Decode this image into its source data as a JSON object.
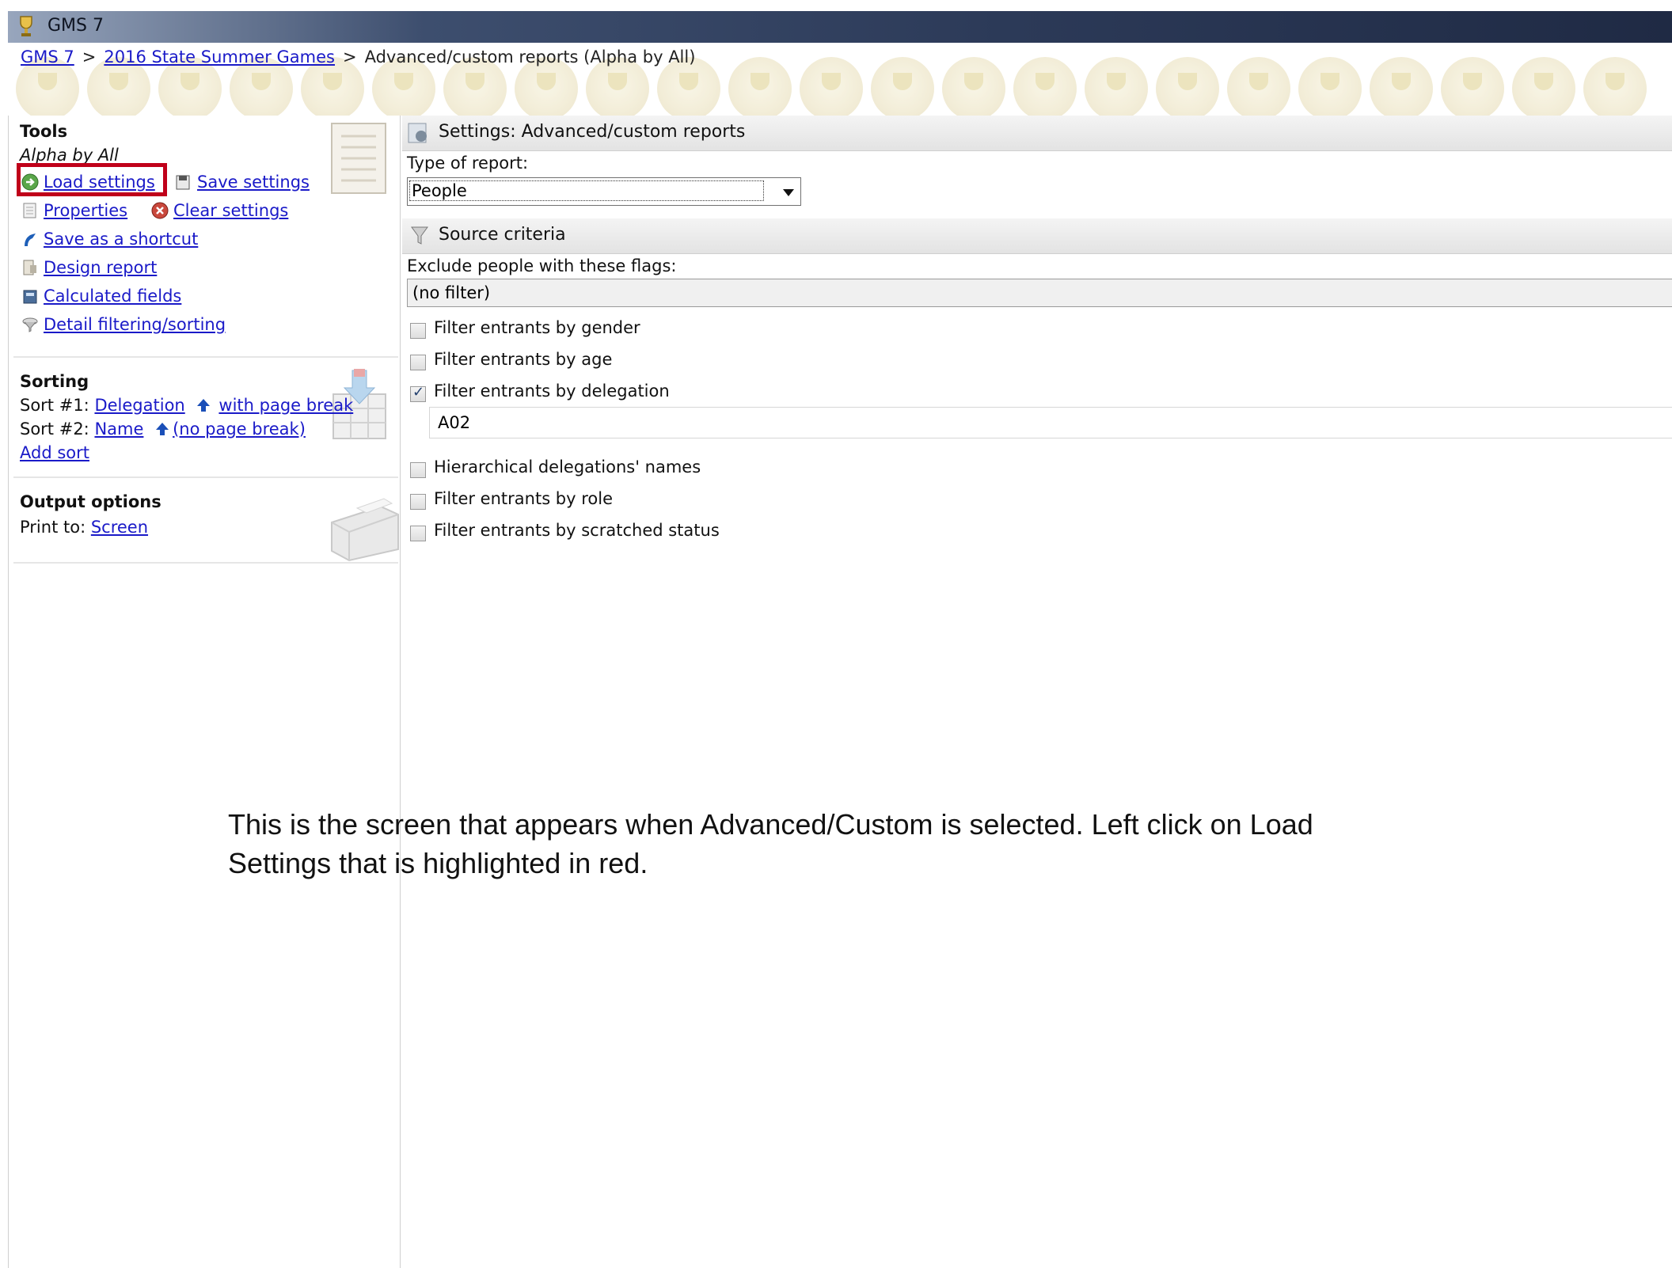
{
  "window": {
    "title": "GMS 7"
  },
  "breadcrumb": {
    "items": [
      {
        "label": "GMS 7"
      },
      {
        "label": "2016 State Summer Games"
      }
    ],
    "current": "Advanced/custom reports (Alpha by All)",
    "separator": ">"
  },
  "tools": {
    "title": "Tools",
    "subtitle": "Alpha by All",
    "load_settings": "Load settings",
    "save_settings": "Save settings",
    "properties": "Properties",
    "clear_settings": "Clear settings",
    "save_shortcut": "Save as a shortcut",
    "design_report": "Design report",
    "calculated_fields": "Calculated fields",
    "detail_filtering": "Detail filtering/sorting"
  },
  "sorting": {
    "title": "Sorting",
    "sort1_label": "Sort #1:",
    "sort1_field": "Delegation",
    "sort1_break": "with page break",
    "sort2_label": "Sort #2:",
    "sort2_field": "Name",
    "sort2_break": "(no page break)",
    "add_sort": "Add sort"
  },
  "output": {
    "title": "Output options",
    "print_label": "Print to:",
    "print_value": "Screen"
  },
  "settings": {
    "header": "Settings: Advanced/custom reports",
    "type_label": "Type of report:",
    "type_value": "People"
  },
  "source": {
    "header": "Source criteria",
    "exclude_label": "Exclude people with these flags:",
    "exclude_value": "(no filter)",
    "filters": [
      {
        "label": "Filter entrants by gender",
        "checked": false
      },
      {
        "label": "Filter entrants by age",
        "checked": false
      },
      {
        "label": "Filter entrants by delegation",
        "checked": true
      },
      {
        "label": "Hierarchical delegations' names",
        "checked": false
      },
      {
        "label": "Filter entrants by role",
        "checked": false
      },
      {
        "label": "Filter entrants by scratched status",
        "checked": false
      }
    ],
    "delegation_value": "A02"
  },
  "caption": {
    "line1": "This is the screen that appears when Advanced/Custom is selected. Left click on Load",
    "line2": "Settings that is highlighted in red."
  },
  "colors": {
    "highlight": "#c0001a",
    "link": "#1a1ac8"
  },
  "icons": [
    "trophy-icon",
    "load-icon",
    "save-icon",
    "properties-icon",
    "clear-icon",
    "shortcut-icon",
    "design-icon",
    "calculator-icon",
    "filter-icon",
    "sort-up-icon",
    "settings-icon",
    "funnel-icon",
    "printer-icon",
    "checklist-icon",
    "sort-grid-icon",
    "dropdown-arrow-icon"
  ]
}
